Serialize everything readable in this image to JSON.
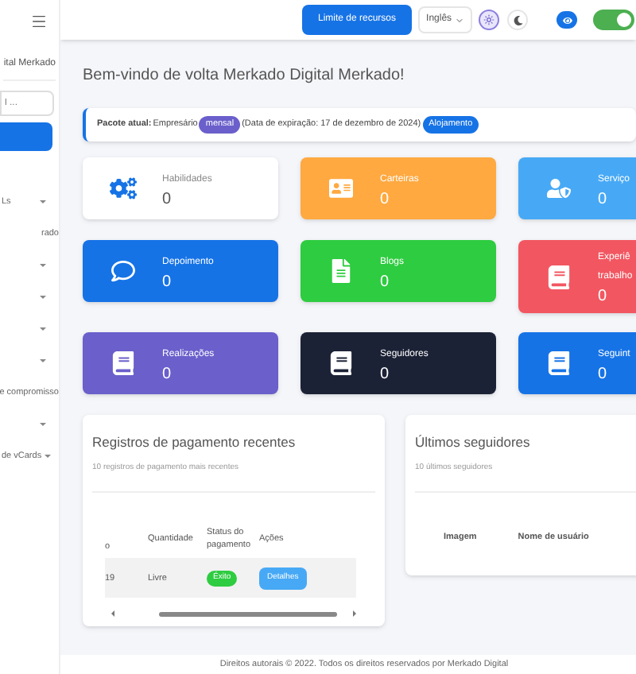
{
  "topbar": {
    "resource_button": "Limite de recursos",
    "language": "Inglês",
    "toggle_on": true
  },
  "sidebar": {
    "title": "ital Merkado",
    "search": {
      "placeholder": "l ..."
    },
    "items": [
      {
        "label": "Ls",
        "has_caret": true
      },
      {
        "label": "rado",
        "has_caret": false
      },
      {
        "has_caret": true
      },
      {
        "has_caret": true
      },
      {
        "has_caret": true
      },
      {
        "has_caret": true
      },
      {
        "label": "e compromisso",
        "has_caret": false
      },
      {
        "has_caret": true
      },
      {
        "label": "de vCards",
        "has_caret": true
      }
    ]
  },
  "welcome": "Bem-vindo de volta Merkado Digital Merkado!",
  "package": {
    "label": "Pacote atual:",
    "name": "Empresário",
    "period": "mensal",
    "expiry": "(Data de expiração: 17 de dezembro de 2024)",
    "action": "Alojamento"
  },
  "cards": [
    {
      "title": "Habilidades",
      "value": "0",
      "kind": "gears",
      "color": "#ffffff"
    },
    {
      "title": "Carteiras",
      "value": "0",
      "kind": "idcard",
      "color": "#ffa940"
    },
    {
      "title": "Serviço",
      "value": "0",
      "kind": "usershield",
      "color": "#47a9f5"
    },
    {
      "title": "Depoimento",
      "value": "0",
      "kind": "comment",
      "color": "#1673e6"
    },
    {
      "title": "Blogs",
      "value": "0",
      "kind": "file",
      "color": "#2ecc40"
    },
    {
      "title": "Experiê\ntrabalho",
      "value": "0",
      "kind": "book",
      "color": "#f25761"
    },
    {
      "title": "Realizações",
      "value": "0",
      "kind": "book",
      "color": "#6a5fcb"
    },
    {
      "title": "Seguidores",
      "value": "0",
      "kind": "book",
      "color": "#1c2236"
    },
    {
      "title": "Seguint",
      "value": "0",
      "kind": "book",
      "color": "#1673e6"
    }
  ],
  "payments": {
    "title": "Registros de pagamento recentes",
    "subtitle": "10 registros de pagamento mais recentes",
    "columns": [
      "o",
      "Quantidade",
      "Status do pagamento",
      "Ações"
    ],
    "rows": [
      {
        "id": "19",
        "amount": "Livre",
        "status": "Éxito",
        "action": "Detalhes"
      }
    ]
  },
  "followers": {
    "title": "Últimos seguidores",
    "subtitle": "10 últimos seguidores",
    "columns": [
      "Imagem",
      "Nome de usuário"
    ]
  },
  "footer": "Direitos autorais © 2022. Todos os direitos reservados por Merkado Digital"
}
